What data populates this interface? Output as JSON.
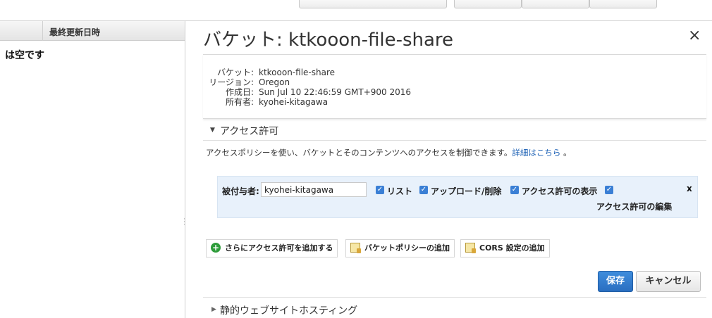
{
  "left_pane": {
    "column_header": "最終更新日時",
    "empty_text": "は空です"
  },
  "panel": {
    "title": "バケット: ktkooon-file-share",
    "close_label": "×"
  },
  "bucket_info": [
    {
      "key": "バケット:",
      "value": "ktkooon-file-share"
    },
    {
      "key": "リージョン:",
      "value": "Oregon"
    },
    {
      "key": "作成日:",
      "value": "Sun Jul 10 22:46:59 GMT+900 2016"
    },
    {
      "key": "所有者:",
      "value": "kyohei-kitagawa"
    }
  ],
  "permissions": {
    "section_title": "アクセス許可",
    "description": "アクセスポリシーを使い、バケットとそのコンテンツへのアクセスを制御できます。",
    "details_link": "詳細はこちら",
    "description_tail": " 。",
    "grantee_label": "被付与者:",
    "grantee_value": "kyohei-kitagawa",
    "checkboxes": [
      {
        "label": "リスト",
        "checked": true
      },
      {
        "label": "アップロード/削除",
        "checked": true
      },
      {
        "label": "アクセス許可の表示",
        "checked": true
      },
      {
        "label": "アクセス許可の編集",
        "checked": true
      }
    ],
    "remove_label": "x",
    "add_permission_button": "さらにアクセス許可を追加する",
    "add_bucket_policy_button": "バケットポリシーの追加",
    "add_cors_button": "CORS 設定の追加",
    "save_button": "保存",
    "cancel_button": "キャンセル"
  },
  "static_hosting": {
    "section_title": "静的ウェブサイトホスティング"
  },
  "colors": {
    "accent_blue": "#2a6ec0",
    "grant_background": "#e8f1fb",
    "link": "#1a5fb4"
  }
}
